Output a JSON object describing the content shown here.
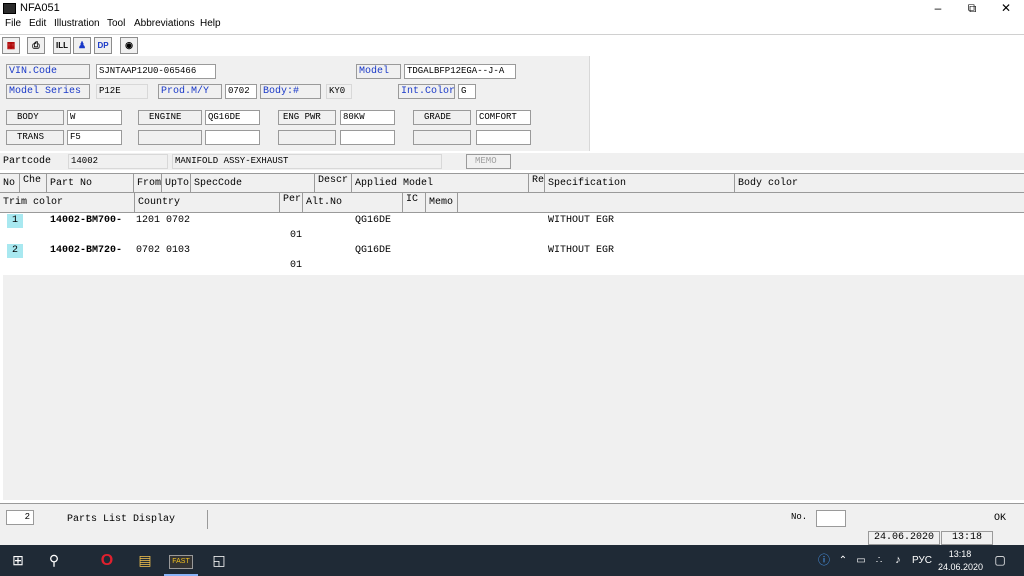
{
  "window": {
    "title": "NFA051"
  },
  "menu": [
    "File",
    "Edit",
    "Illustration",
    "Tool",
    "Abbreviations",
    "Help"
  ],
  "toolbar": {
    "ill_label": "ILL",
    "dp_label": "DP"
  },
  "header": {
    "vin_label": "VIN.Code",
    "vin_value": "SJNTAAP12U0-065466",
    "model_label": "Model",
    "model_value": "TDGALBFP12EGA--J-A",
    "model_series_label": "Model Series",
    "model_series_value": "P12E",
    "prod_label": "Prod.M/Y",
    "prod_value": "0702",
    "body_num_label": "Body:#",
    "body_num_value": "KY0",
    "int_color_label": "Int.Color",
    "int_color_value": "G",
    "body_label": "BODY",
    "body_value": "W",
    "engine_label": "ENGINE",
    "engine_value": "QG16DE",
    "eng_pwr_label": "ENG PWR",
    "eng_pwr_value": "80KW",
    "grade_label": "GRADE",
    "grade_value": "COMFORT",
    "trans_label": "TRANS",
    "trans_value": "F5"
  },
  "partcode": {
    "label": "Partcode",
    "value": "14002",
    "description": "MANIFOLD ASSY-EXHAUST",
    "memo_label": "MEMO"
  },
  "grid": {
    "headers1": [
      "No",
      "Che",
      "Part No",
      "From",
      "UpTo",
      "SpecCode",
      "Descr",
      "Applied Model",
      "Re",
      "Specification",
      "Body color"
    ],
    "headers2": [
      "Trim color",
      "Country",
      "Per",
      "Alt.No",
      "IC",
      "Memo"
    ],
    "rows": [
      {
        "no": "1",
        "part_no": "14002-BM700-",
        "from": "1201",
        "upto": "0702",
        "applied_model": "QG16DE",
        "specification": "WITHOUT EGR",
        "per": "01"
      },
      {
        "no": "2",
        "part_no": "14002-BM720-",
        "from": "0702",
        "upto": "0103",
        "applied_model": "QG16DE",
        "specification": "WITHOUT EGR",
        "per": "01"
      }
    ]
  },
  "status": {
    "count": "2",
    "mode": "Parts List Display",
    "no_label": "No.",
    "ok_label": "OK",
    "date": "24.06.2020",
    "time": "13:18"
  },
  "taskbar": {
    "lang": "РУС",
    "time": "13:18",
    "date": "24.06.2020",
    "fast_label": "FAST"
  },
  "colors": {
    "accent_blue": "#1a39c8",
    "row_highlight": "#a8e8f0",
    "taskbar": "#1f2a36"
  }
}
